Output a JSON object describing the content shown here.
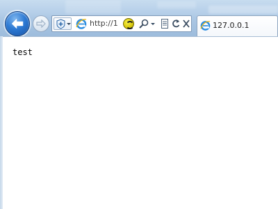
{
  "toolbar": {
    "address_text": "http://1",
    "icons": {
      "back": "back-arrow-icon",
      "forward": "forward-arrow-icon",
      "security": "shield-plus-icon",
      "site": "ie-logo-icon",
      "compatibility": "compatibility-view-icon",
      "search": "search-icon",
      "page": "page-icon",
      "refresh": "refresh-icon",
      "stop": "stop-icon"
    }
  },
  "tab": {
    "label": "127.0.0.1"
  },
  "page": {
    "body_text": "test"
  },
  "colors": {
    "accent": "#2d7ad4",
    "chrome": "#b8d1ea",
    "ie_logo": "#2b8de0",
    "compat_yellow": "#e6d412"
  }
}
